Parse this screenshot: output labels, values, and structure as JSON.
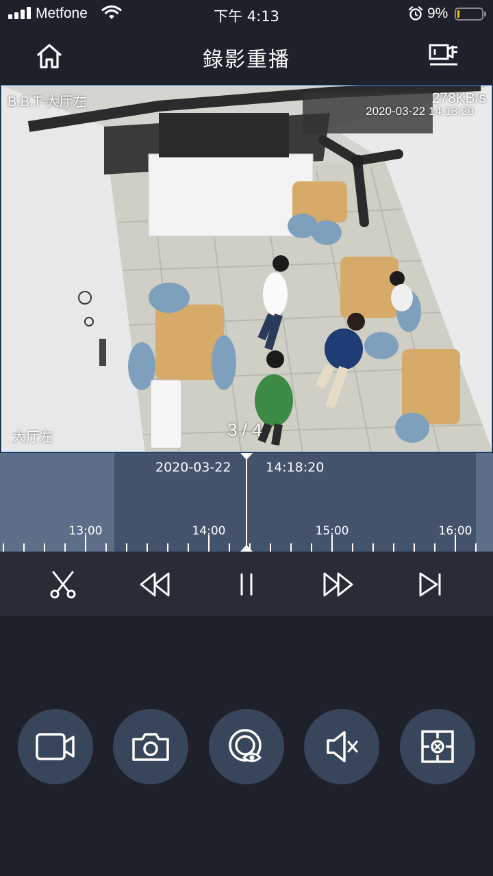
{
  "status_bar": {
    "carrier": "Metfone",
    "time": "下午 4:13",
    "battery_percent": "9%",
    "battery_level": 0.09,
    "battery_color": "#f5c400"
  },
  "nav": {
    "title": "錄影重播",
    "left_icon": "home-icon",
    "right_icon": "recording-list-icon"
  },
  "video": {
    "camera_name": "B.B.T-大厅左",
    "bitrate": "278KB/s",
    "timestamp": "2020-03-22 14:18:20",
    "channel_label": "大厅左",
    "page_indicator": "3 / 4"
  },
  "timeline": {
    "current_date": "2020-03-22",
    "current_time": "14:18:20",
    "hour_labels": [
      "13:00",
      "14:00",
      "15:00",
      "16:00"
    ],
    "colors": {
      "background": "#5c6e88",
      "recorded": "#43536c",
      "cursor": "#ffffff"
    }
  },
  "playback_controls": [
    {
      "name": "clip-icon",
      "action": "clip"
    },
    {
      "name": "rewind-icon",
      "action": "rewind"
    },
    {
      "name": "pause-icon",
      "action": "pause"
    },
    {
      "name": "fast-forward-icon",
      "action": "fast-forward"
    },
    {
      "name": "next-icon",
      "action": "next"
    }
  ],
  "actions": [
    {
      "name": "record-video-icon",
      "action": "record"
    },
    {
      "name": "snapshot-icon",
      "action": "snapshot"
    },
    {
      "name": "view-icon",
      "action": "view"
    },
    {
      "name": "mute-icon",
      "action": "mute"
    },
    {
      "name": "fullscreen-icon",
      "action": "fullscreen"
    }
  ],
  "accent_color": "#2f7de0"
}
